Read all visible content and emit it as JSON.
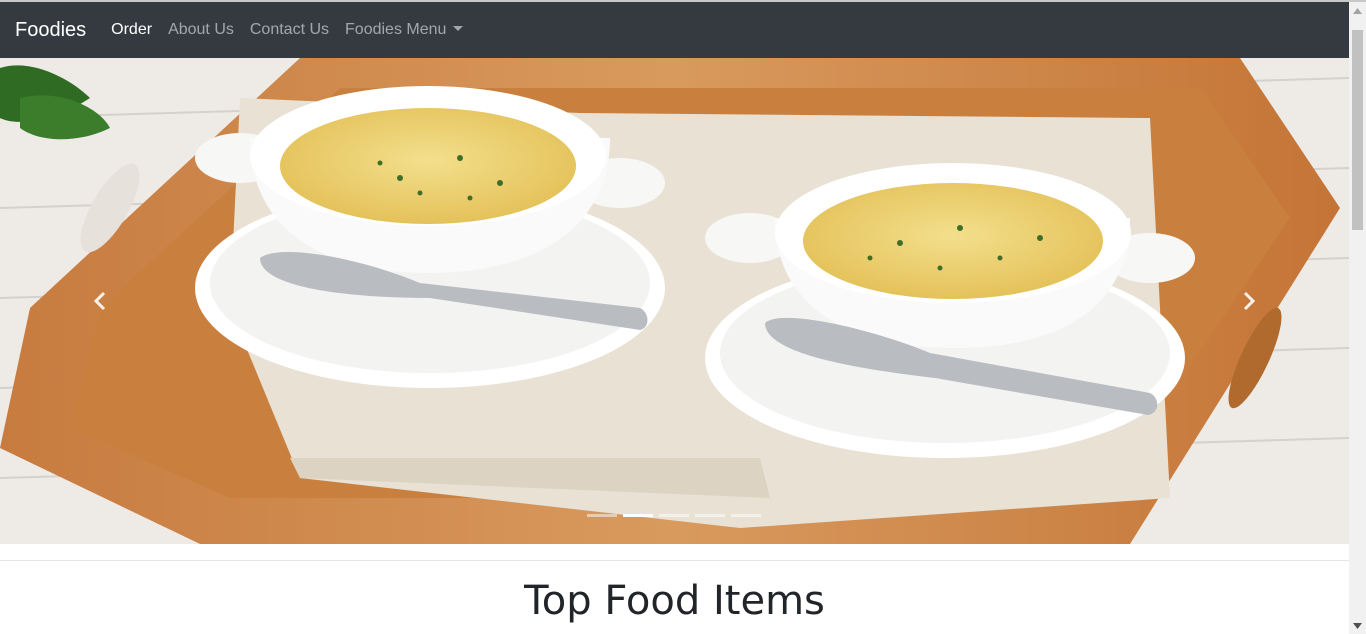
{
  "navbar": {
    "brand": "Foodies",
    "links": [
      "Order",
      "About Us",
      "Contact Us",
      "Foodies Menu"
    ],
    "active_index": 0
  },
  "carousel": {
    "slide_count": 5,
    "active_slide": 2,
    "prev_icon": "chevron-left-icon",
    "next_icon": "chevron-right-icon"
  },
  "section": {
    "title": "Top Food Items"
  },
  "colors": {
    "navbar_bg": "#343a40",
    "nav_active": "#ffffff",
    "nav_inactive": "rgba(255,255,255,0.55)"
  }
}
